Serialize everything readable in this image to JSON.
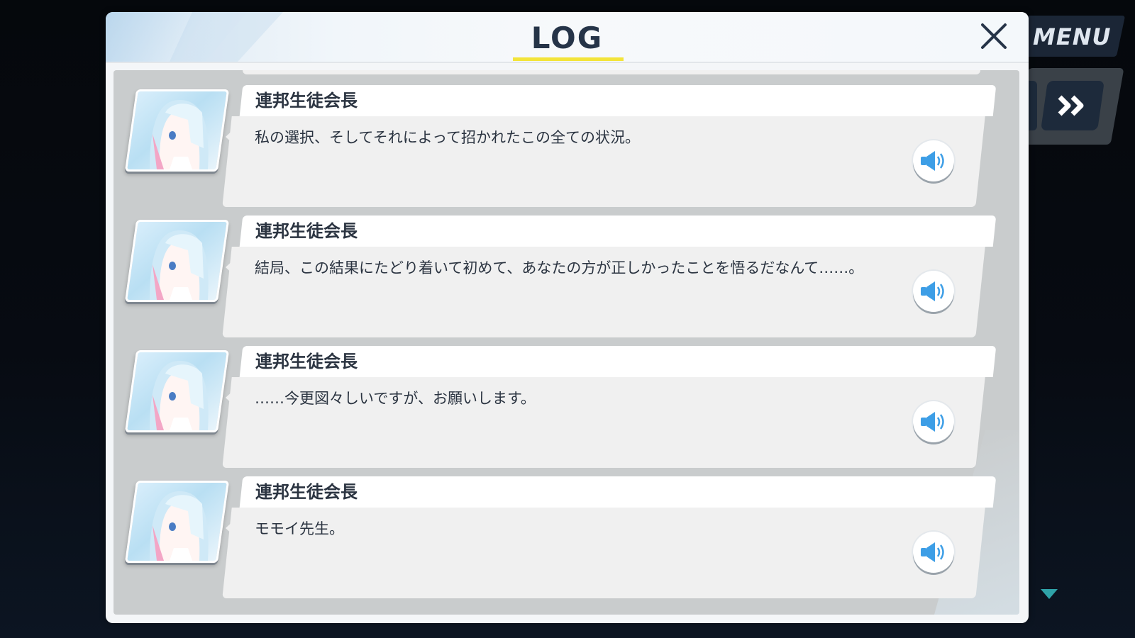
{
  "hud": {
    "menu_label": "MENU"
  },
  "log": {
    "title": "LOG",
    "accent_color": "#f3e43a",
    "close_icon": "close-icon",
    "entries": [
      {
        "speaker": "連邦生徒会長",
        "text": "私の選択、そしてそれによって招かれたこの全ての状況。"
      },
      {
        "speaker": "連邦生徒会長",
        "text": "結局、この結果にたどり着いて初めて、あなたの方が正しかったことを悟るだなんて……。"
      },
      {
        "speaker": "連邦生徒会長",
        "text": "……今更図々しいですが、お願いします。"
      },
      {
        "speaker": "連邦生徒会長",
        "text": "モモイ先生。"
      }
    ]
  }
}
